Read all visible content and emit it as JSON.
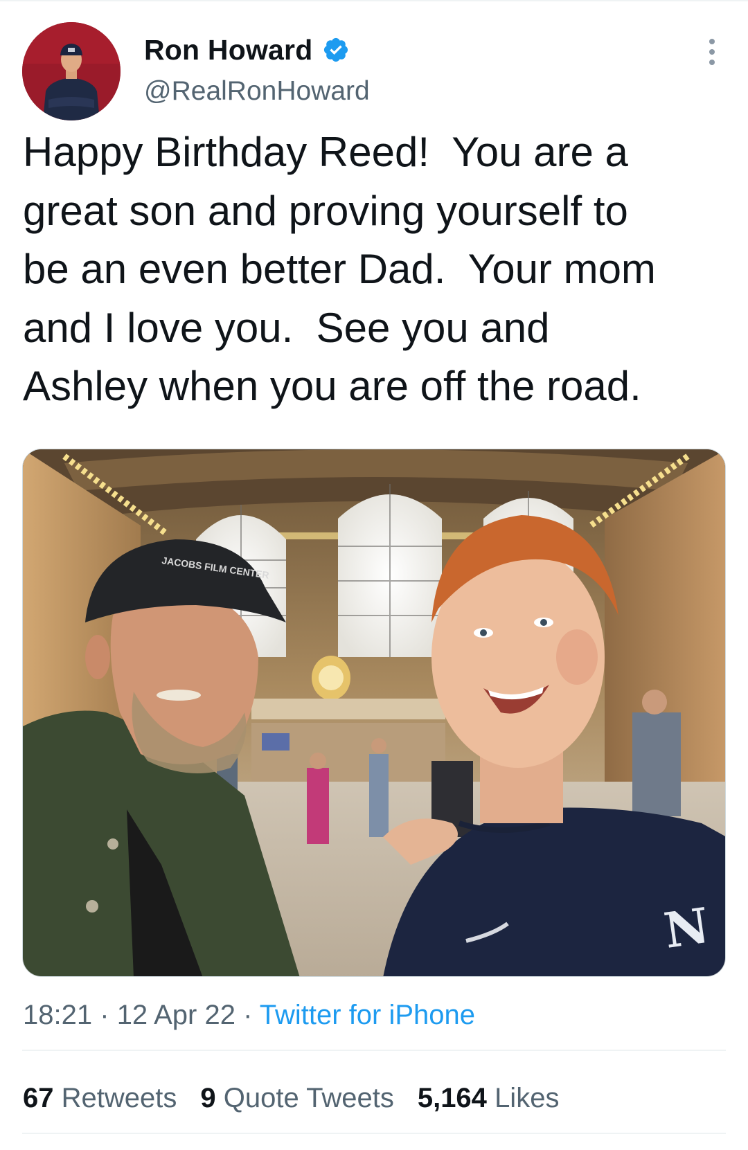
{
  "tweet": {
    "author": {
      "display_name": "Ron Howard",
      "handle": "@RealRonHoward",
      "verified": true
    },
    "text": "Happy Birthday Reed!  You are a\ngreat son and proving yourself to\nbe an even better Dad.  Your mom\nand I love you.  See you and\nAshley when you are off the road.",
    "time": "18:21",
    "separator": "·",
    "date": "12 Apr 22",
    "source": "Twitter for iPhone",
    "stats": {
      "retweets_count": "67",
      "retweets_label": "Retweets",
      "quotes_count": "9",
      "quotes_label": "Quote Tweets",
      "likes_count": "5,164",
      "likes_label": "Likes"
    },
    "photo": {
      "cap_text": "JACOBS FILM CENTER"
    }
  },
  "colors": {
    "text_primary": "#0f1419",
    "text_secondary": "#536471",
    "link": "#1d9bf0",
    "verified": "#1d9bf0",
    "divider": "#eff3f4"
  }
}
